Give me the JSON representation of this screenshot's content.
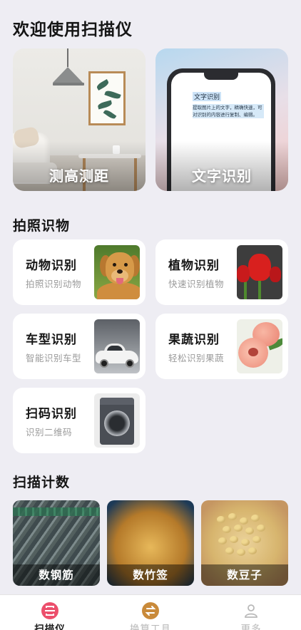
{
  "page": {
    "title": "欢迎使用扫描仪"
  },
  "hero": [
    {
      "label": "测高测距",
      "image": "living-room-photo"
    },
    {
      "label": "文字识别",
      "image": "phone-text-photo",
      "doc_title": "文字识别",
      "doc_body": "提取图片上的文字，精确快速，可对识别的内容进行复制、编辑。"
    }
  ],
  "photo_section": {
    "title": "拍照识物",
    "cards": [
      {
        "title": "动物识别",
        "subtitle": "拍照识别动物",
        "image": "golden-retriever"
      },
      {
        "title": "植物识别",
        "subtitle": "快速识别植物",
        "image": "red-tulips"
      },
      {
        "title": "车型识别",
        "subtitle": "智能识别车型",
        "image": "white-sports-car"
      },
      {
        "title": "果蔬识别",
        "subtitle": "轻松识别果蔬",
        "image": "peaches"
      },
      {
        "title": "扫码识别",
        "subtitle": "识别二维码",
        "image": "washing-machine"
      }
    ]
  },
  "count_section": {
    "title": "扫描计数",
    "tiles": [
      {
        "label": "数钢筋",
        "image": "steel-rebar-bundle"
      },
      {
        "label": "数竹签",
        "image": "bamboo-skewers"
      },
      {
        "label": "数豆子",
        "image": "soybeans-in-hand"
      }
    ]
  },
  "tabbar": {
    "tabs": [
      {
        "label": "扫描仪",
        "icon": "scanner-icon",
        "active": true
      },
      {
        "label": "换算工具",
        "icon": "convert-icon",
        "active": false
      },
      {
        "label": "更多",
        "icon": "user-icon",
        "active": false
      }
    ]
  },
  "colors": {
    "background": "#eeedf3",
    "card": "#ffffff",
    "scanner_accent": "#ec4f6c",
    "convert_icon": "#c98a3a",
    "inactive": "#b9b9b9"
  }
}
